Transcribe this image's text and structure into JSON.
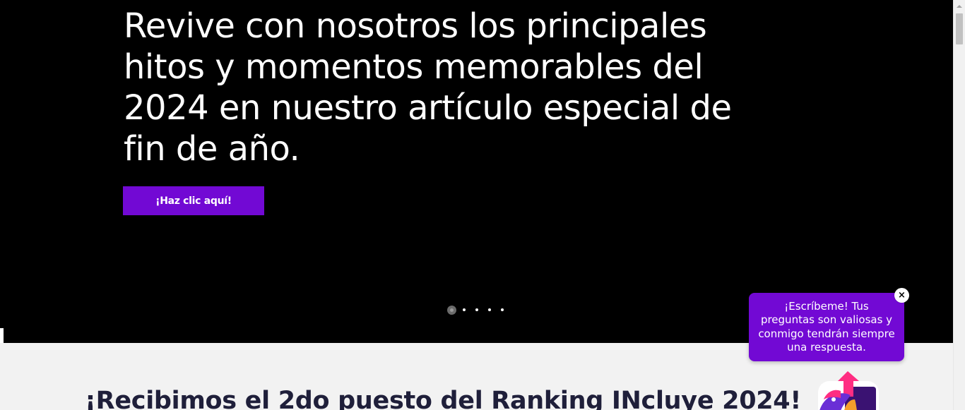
{
  "hero": {
    "title": "Revive con nosotros los principales hitos y momentos memorables del 2024 en nuestro artículo especial de fin de año.",
    "cta_label": "¡Haz clic aquí!",
    "slide_count": 5,
    "active_slide": 1
  },
  "section": {
    "title": "¡Recibimos el 2do puesto del Ranking INcluye 2024!"
  },
  "chat": {
    "message": "¡Escríbeme! Tus preguntas son valiosas y conmigo tendrán siempre una respuesta.",
    "close_label": "×"
  },
  "icons": {
    "close": "close-icon",
    "badge": "ranking-badge-logo",
    "scroll_up": "chevron-up-icon"
  },
  "colors": {
    "hero_background": "#000000",
    "accent_purple": "#7209d4",
    "page_background": "#f2f2f2",
    "section_title": "#1f1f3a"
  }
}
